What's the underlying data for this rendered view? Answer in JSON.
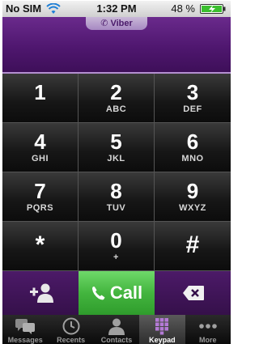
{
  "status_bar": {
    "carrier": "No SIM",
    "time": "1:32 PM",
    "battery": "48 %"
  },
  "header": {
    "app_name": "Viber",
    "icon": "phone-icon"
  },
  "keypad": {
    "keys": [
      {
        "digit": "1",
        "letters": ""
      },
      {
        "digit": "2",
        "letters": "ABC"
      },
      {
        "digit": "3",
        "letters": "DEF"
      },
      {
        "digit": "4",
        "letters": "GHI"
      },
      {
        "digit": "5",
        "letters": "JKL"
      },
      {
        "digit": "6",
        "letters": "MNO"
      },
      {
        "digit": "7",
        "letters": "PQRS"
      },
      {
        "digit": "8",
        "letters": "TUV"
      },
      {
        "digit": "9",
        "letters": "WXYZ"
      },
      {
        "digit": "*",
        "letters": ""
      },
      {
        "digit": "0",
        "letters": "+"
      },
      {
        "digit": "#",
        "letters": ""
      }
    ]
  },
  "actions": {
    "add_contact_icon": "add-contact-icon",
    "call_label": "Call",
    "call_icon": "phone-icon",
    "delete_icon": "backspace-icon"
  },
  "tabs": [
    {
      "label": "Messages",
      "icon": "messages-icon",
      "active": false
    },
    {
      "label": "Recents",
      "icon": "clock-icon",
      "active": false
    },
    {
      "label": "Contacts",
      "icon": "person-icon",
      "active": false
    },
    {
      "label": "Keypad",
      "icon": "keypad-icon",
      "active": true
    },
    {
      "label": "More",
      "icon": "more-icon",
      "active": false
    }
  ],
  "colors": {
    "header_purple": "#4f176f",
    "call_green": "#43b53e",
    "key_black": "#161616"
  }
}
